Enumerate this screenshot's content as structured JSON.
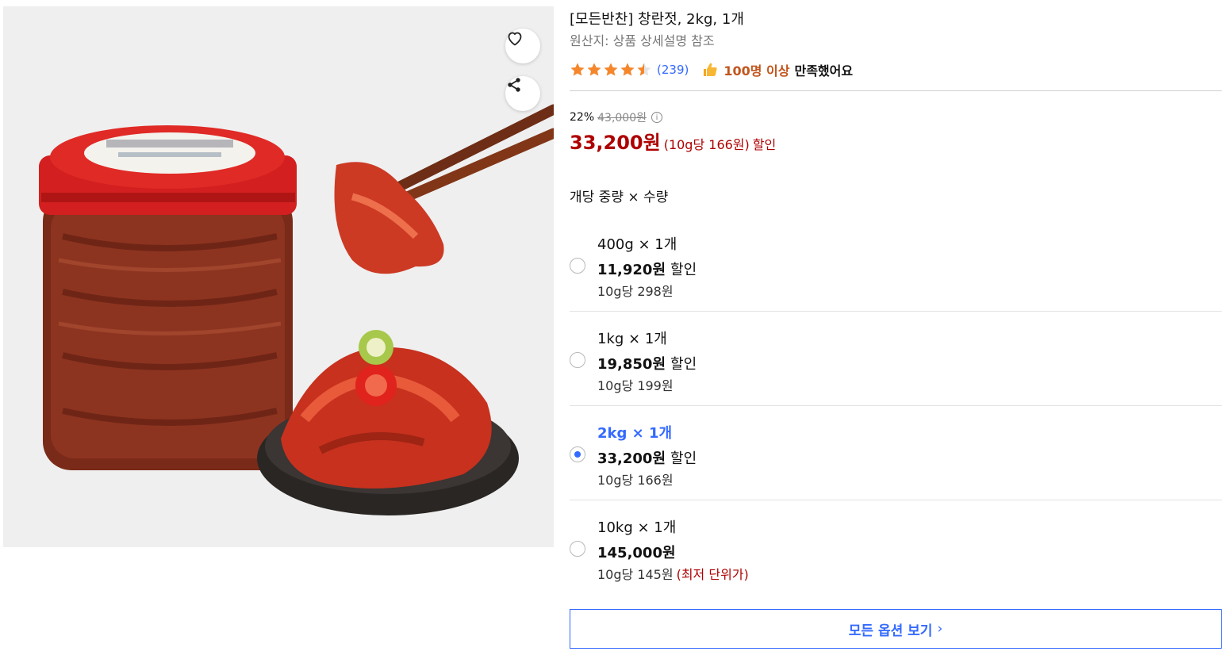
{
  "product": {
    "title": "[모든반찬] 창란젓, 2kg, 1개",
    "origin": "원산지: 상품 상세설명 참조",
    "rating": 4.5,
    "review_count": "(239)",
    "satisfaction_highlight": "100명 이상",
    "satisfaction_rest": "만족했어요"
  },
  "pricing": {
    "discount_rate": "22%",
    "original_price": "43,000원",
    "sale_price": "33,200원",
    "unit_price": "(10g당 166원)",
    "discount_label": "할인"
  },
  "options_section": {
    "label": "개당 중량 × 수량",
    "items": [
      {
        "name": "400g  ×  1개",
        "price": "11,920원",
        "discount": "할인",
        "unit": "10g당 298원",
        "note": "",
        "selected": false
      },
      {
        "name": "1kg  ×  1개",
        "price": "19,850원",
        "discount": "할인",
        "unit": "10g당 199원",
        "note": "",
        "selected": false
      },
      {
        "name": "2kg  ×  1개",
        "price": "33,200원",
        "discount": "할인",
        "unit": "10g당 166원",
        "note": "",
        "selected": true
      },
      {
        "name": "10kg  ×  1개",
        "price": "145,000원",
        "discount": "",
        "unit": "10g당 145원",
        "note": "(최저 단위가)",
        "selected": false
      }
    ],
    "view_all": "모든 옵션 보기",
    "view_all_chevron": "›"
  },
  "icons": {
    "wishlist": "heart-outline-icon",
    "share": "share-icon",
    "info": "info-icon",
    "thumb": "thumbs-up-icon"
  },
  "colors": {
    "accent_blue": "#346aff",
    "price_red": "#ae0000",
    "star_orange": "#f5862a",
    "satisfaction_orange": "#c2551c"
  }
}
